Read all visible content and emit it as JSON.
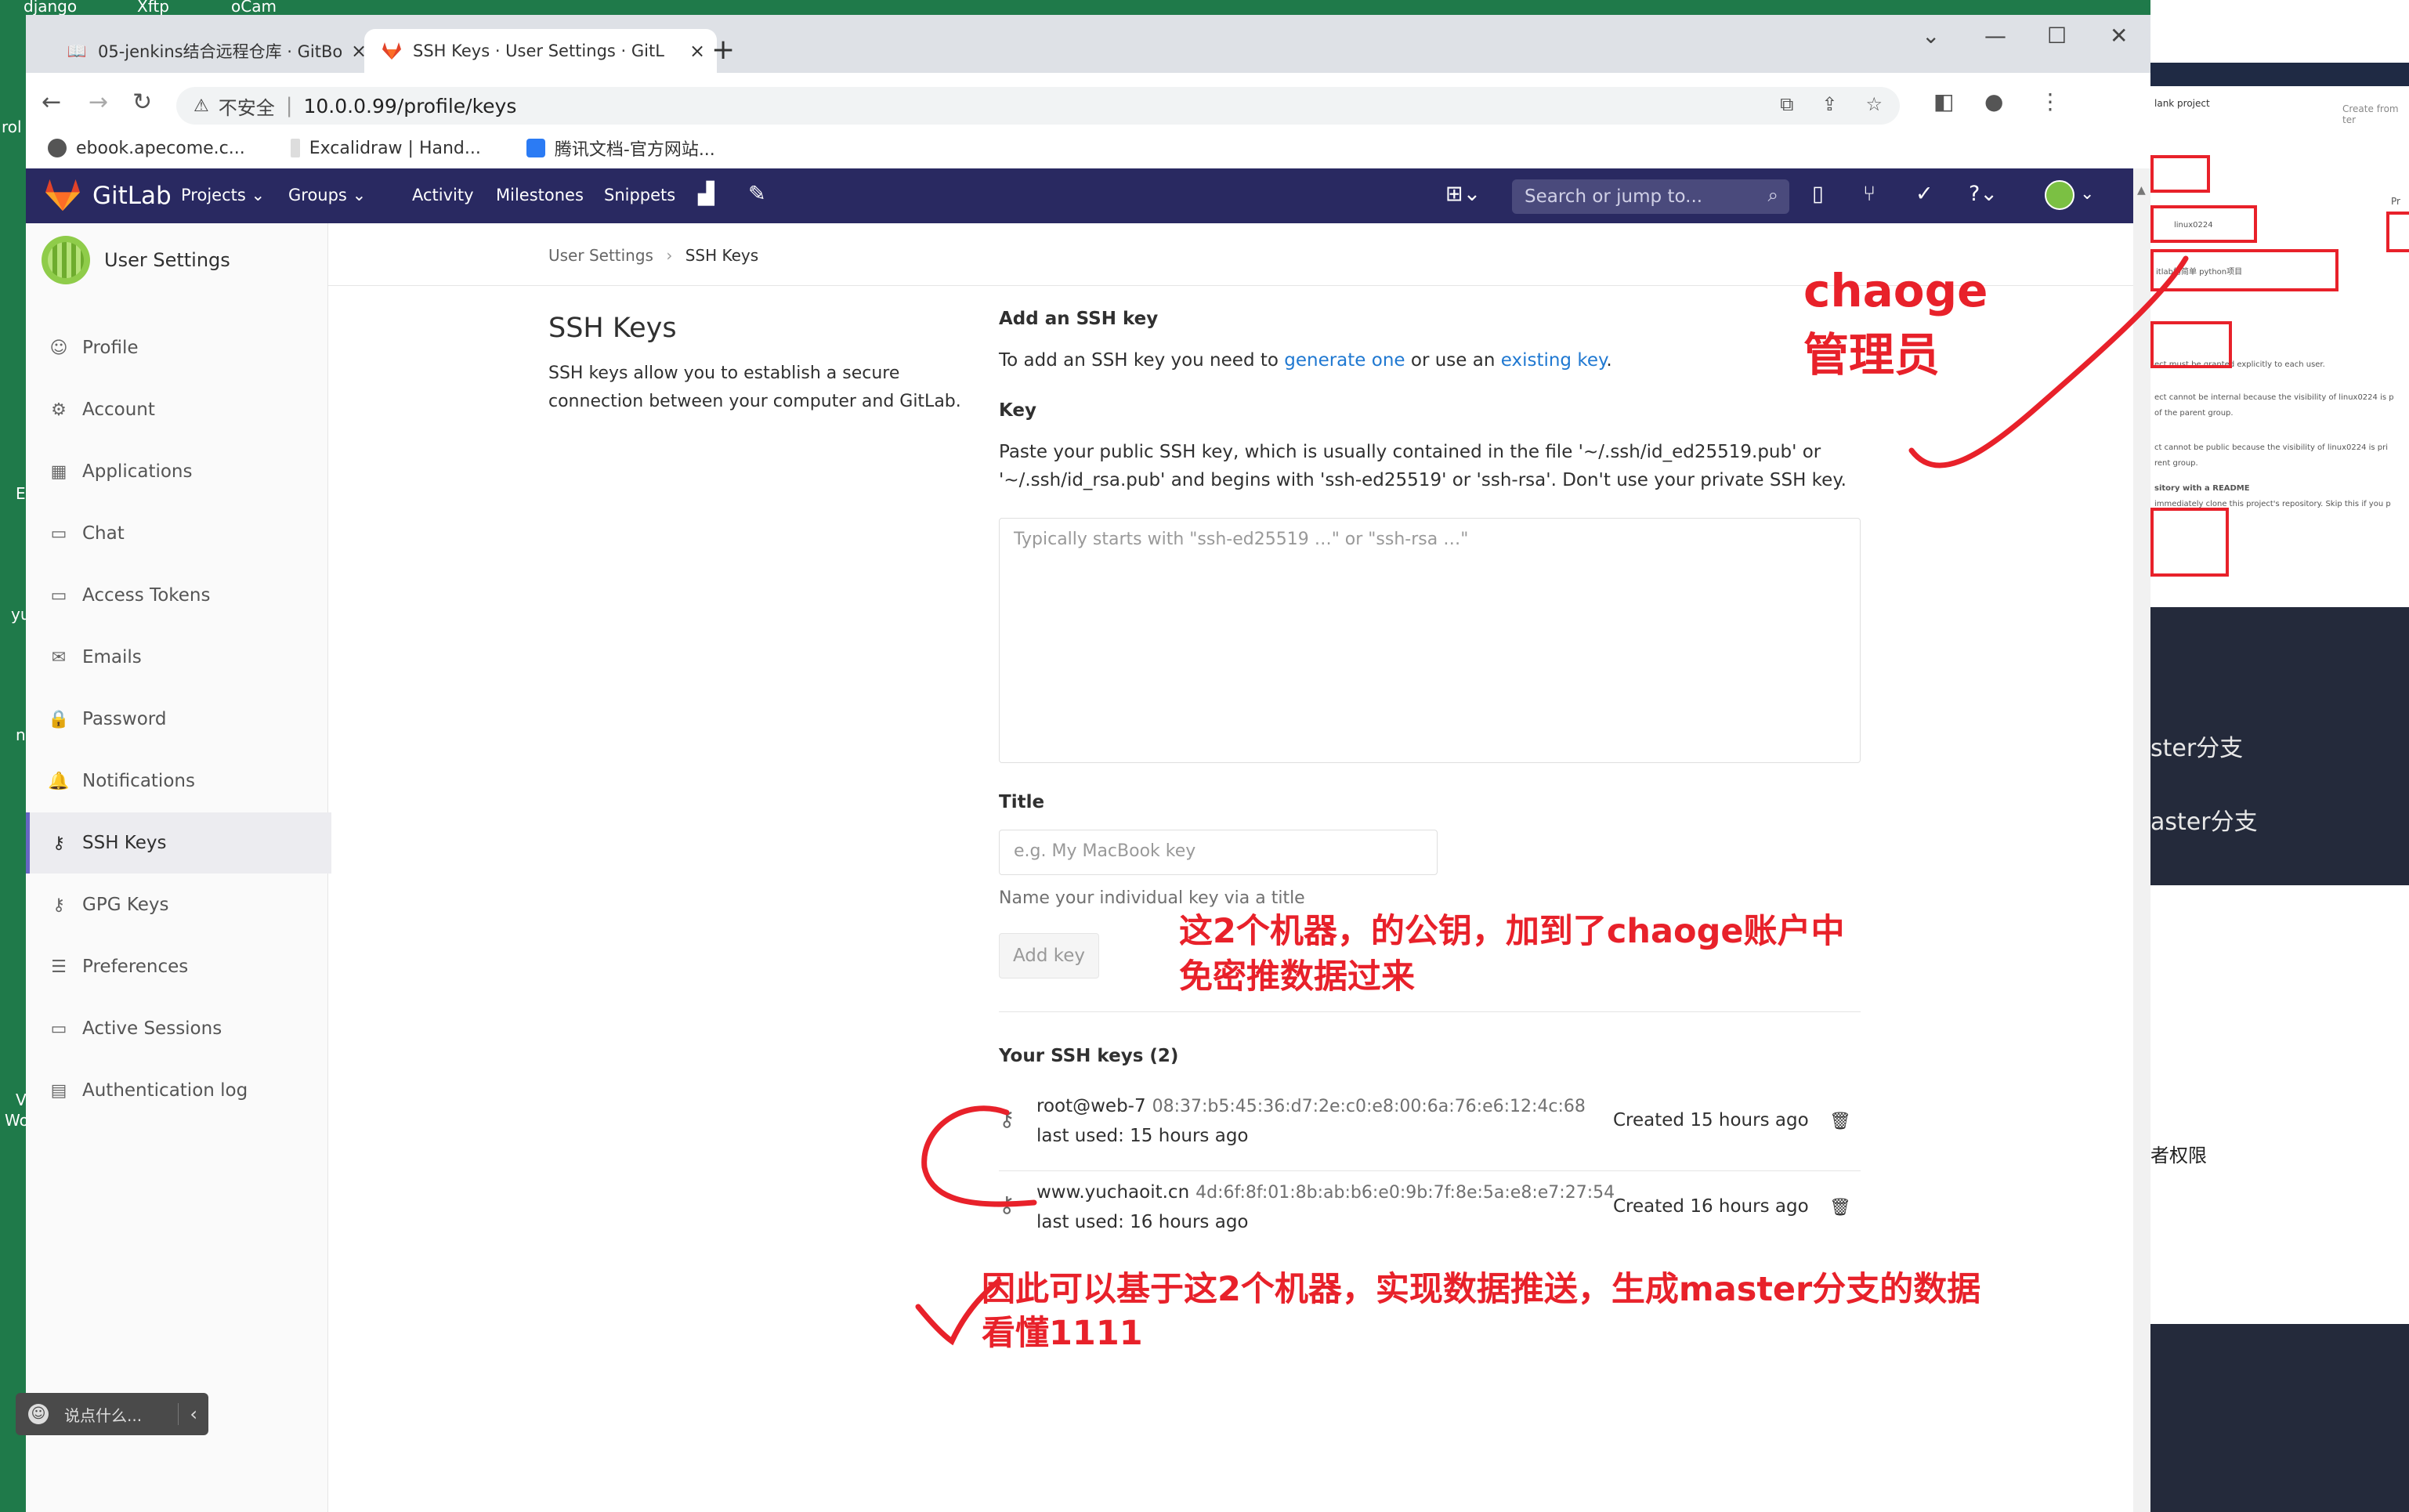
{
  "desktop": {
    "labels": [
      "django",
      "Xftp",
      "oCam",
      "rol",
      "yu",
      "n",
      "V",
      "Wo",
      "E"
    ],
    "right_panel": {
      "tab_blank": "lank project",
      "tab_create": "Create from ter",
      "line1": "linux0224",
      "line2": "itlab的简单 python项目",
      "line3": "ect must be granted explicitly to each user.",
      "line4": "ect cannot be internal because the visibility of linux0224 is p",
      "line5": "of the parent group.",
      "line6": "ct cannot be public because the visibility of linux0224 is pri",
      "line7": "rent group.",
      "line8": "sitory with a README",
      "line9": "immediately clone this project's repository. Skip this if you p",
      "branch1": "ster分支",
      "branch2": "aster分支",
      "perm": "者权限",
      "pr_label": "Pr"
    }
  },
  "browser": {
    "tabs": [
      {
        "title": "05-jenkins结合远程仓库 · GitBo",
        "icon": "book-icon"
      },
      {
        "title": "SSH Keys · User Settings · GitL",
        "icon": "gitlab-tanuki-icon"
      }
    ],
    "address": {
      "insecure_label": "不安全",
      "url": "10.0.0.99/profile/keys"
    },
    "bookmarks": [
      {
        "label": "ebook.apecome.c...",
        "color": "#555555"
      },
      {
        "label": "Excalidraw | Hand...",
        "color": "#cccccc"
      },
      {
        "label": "腾讯文档-官方网站...",
        "color": "#2b7bf4"
      }
    ]
  },
  "gitlab": {
    "brand": "GitLab",
    "nav": [
      "Projects",
      "Groups",
      "Activity",
      "Milestones",
      "Snippets"
    ],
    "search_placeholder": "Search or jump to..."
  },
  "sidebar": {
    "title": "User Settings",
    "items": [
      {
        "label": "Profile",
        "icon": "profile-icon",
        "glyph": "☺"
      },
      {
        "label": "Account",
        "icon": "account-icon",
        "glyph": "⚙"
      },
      {
        "label": "Applications",
        "icon": "applications-icon",
        "glyph": "▦"
      },
      {
        "label": "Chat",
        "icon": "chat-icon",
        "glyph": "▭"
      },
      {
        "label": "Access Tokens",
        "icon": "access-tokens-icon",
        "glyph": "▭"
      },
      {
        "label": "Emails",
        "icon": "emails-icon",
        "glyph": "✉"
      },
      {
        "label": "Password",
        "icon": "password-icon",
        "glyph": "🔒"
      },
      {
        "label": "Notifications",
        "icon": "notifications-icon",
        "glyph": "🔔"
      },
      {
        "label": "SSH Keys",
        "icon": "ssh-keys-icon",
        "glyph": "⚷"
      },
      {
        "label": "GPG Keys",
        "icon": "gpg-keys-icon",
        "glyph": "⚷"
      },
      {
        "label": "Preferences",
        "icon": "preferences-icon",
        "glyph": "☰"
      },
      {
        "label": "Active Sessions",
        "icon": "active-sessions-icon",
        "glyph": "▭"
      },
      {
        "label": "Authentication log",
        "icon": "authentication-log-icon",
        "glyph": "▤"
      }
    ],
    "active_index": 8
  },
  "main": {
    "breadcrumb": {
      "parent": "User Settings",
      "current": "SSH Keys"
    },
    "heading": "SSH Keys",
    "intro": "SSH keys allow you to establish a secure connection between your computer and GitLab.",
    "add_heading": "Add an SSH key",
    "add_text_pre": "To add an SSH key you need to ",
    "add_link_generate": "generate one",
    "add_text_mid": " or use an ",
    "add_link_existing": "existing key",
    "add_text_post": ".",
    "key_label": "Key",
    "key_help": "Paste your public SSH key, which is usually contained in the file '~/.ssh/id_ed25519.pub' or '~/.ssh/id_rsa.pub' and begins with 'ssh-ed25519' or 'ssh-rsa'. Don't use your private SSH key.",
    "key_placeholder": "Typically starts with \"ssh-ed25519 …\" or \"ssh-rsa …\"",
    "title_label": "Title",
    "title_placeholder": "e.g. My MacBook key",
    "title_hint": "Name your individual key via a title",
    "add_button": "Add key",
    "your_keys_heading": "Your SSH keys (2)",
    "keys": [
      {
        "title": "root@web-7",
        "fingerprint": "08:37:b5:45:36:d7:2e:c0:e8:00:6a:76:e6:12:4c:68",
        "last_used": "last used: 15 hours ago",
        "created": "Created 15 hours ago"
      },
      {
        "title": "www.yuchaoit.cn",
        "fingerprint": "4d:6f:8f:01:8b:ab:b6:e0:9b:7f:8e:5a:e8:e7:27:54",
        "last_used": "last used: 16 hours ago",
        "created": "Created 16 hours ago"
      }
    ]
  },
  "annotations": {
    "chaoge_line1": "chaoge",
    "chaoge_line2": "管理员",
    "note2_line1": "这2个机器，的公钥，加到了chaoge账户中",
    "note2_line2": "免密推数据过来",
    "note3_line1": "因此可以基于这2个机器，实现数据推送，生成master分支的数据",
    "note3_line2": "看懂1111",
    "color": "#e8212a"
  },
  "chat_widget": {
    "placeholder": "说点什么..."
  }
}
